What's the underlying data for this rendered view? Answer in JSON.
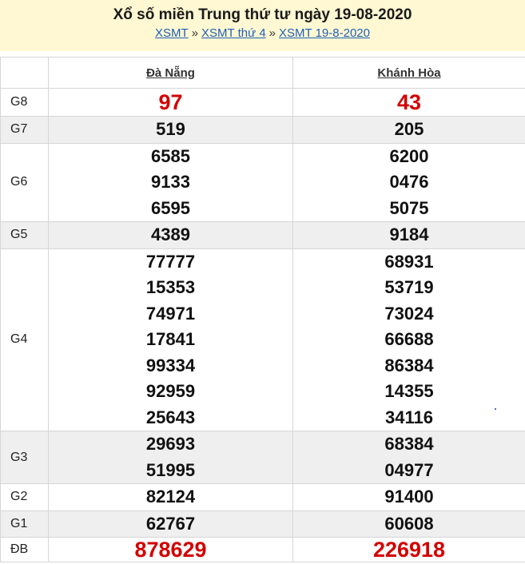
{
  "header": {
    "title": "Xổ số miền Trung thứ tư ngày 19-08-2020",
    "breadcrumbs": [
      "XSMT",
      "XSMT thứ 4",
      "XSMT 19-8-2020"
    ],
    "separator": "»"
  },
  "provinces": [
    "Đà Nẵng",
    "Khánh Hòa"
  ],
  "prizes": [
    {
      "label": "G8",
      "col1": [
        "97"
      ],
      "col2": [
        "43"
      ]
    },
    {
      "label": "G7",
      "col1": [
        "519"
      ],
      "col2": [
        "205"
      ]
    },
    {
      "label": "G6",
      "col1": [
        "6585",
        "9133",
        "6595"
      ],
      "col2": [
        "6200",
        "0476",
        "5075"
      ]
    },
    {
      "label": "G5",
      "col1": [
        "4389"
      ],
      "col2": [
        "9184"
      ]
    },
    {
      "label": "G4",
      "col1": [
        "77777",
        "15353",
        "74971",
        "17841",
        "99334",
        "92959",
        "25643"
      ],
      "col2": [
        "68931",
        "53719",
        "73024",
        "66688",
        "86384",
        "14355",
        "34116"
      ]
    },
    {
      "label": "G3",
      "col1": [
        "29693",
        "51995"
      ],
      "col2": [
        "68384",
        "04977"
      ]
    },
    {
      "label": "G2",
      "col1": [
        "82124"
      ],
      "col2": [
        "91400"
      ]
    },
    {
      "label": "G1",
      "col1": [
        "62767"
      ],
      "col2": [
        "60608"
      ]
    },
    {
      "label": "ĐB",
      "col1": [
        "878629"
      ],
      "col2": [
        "226918"
      ]
    }
  ]
}
